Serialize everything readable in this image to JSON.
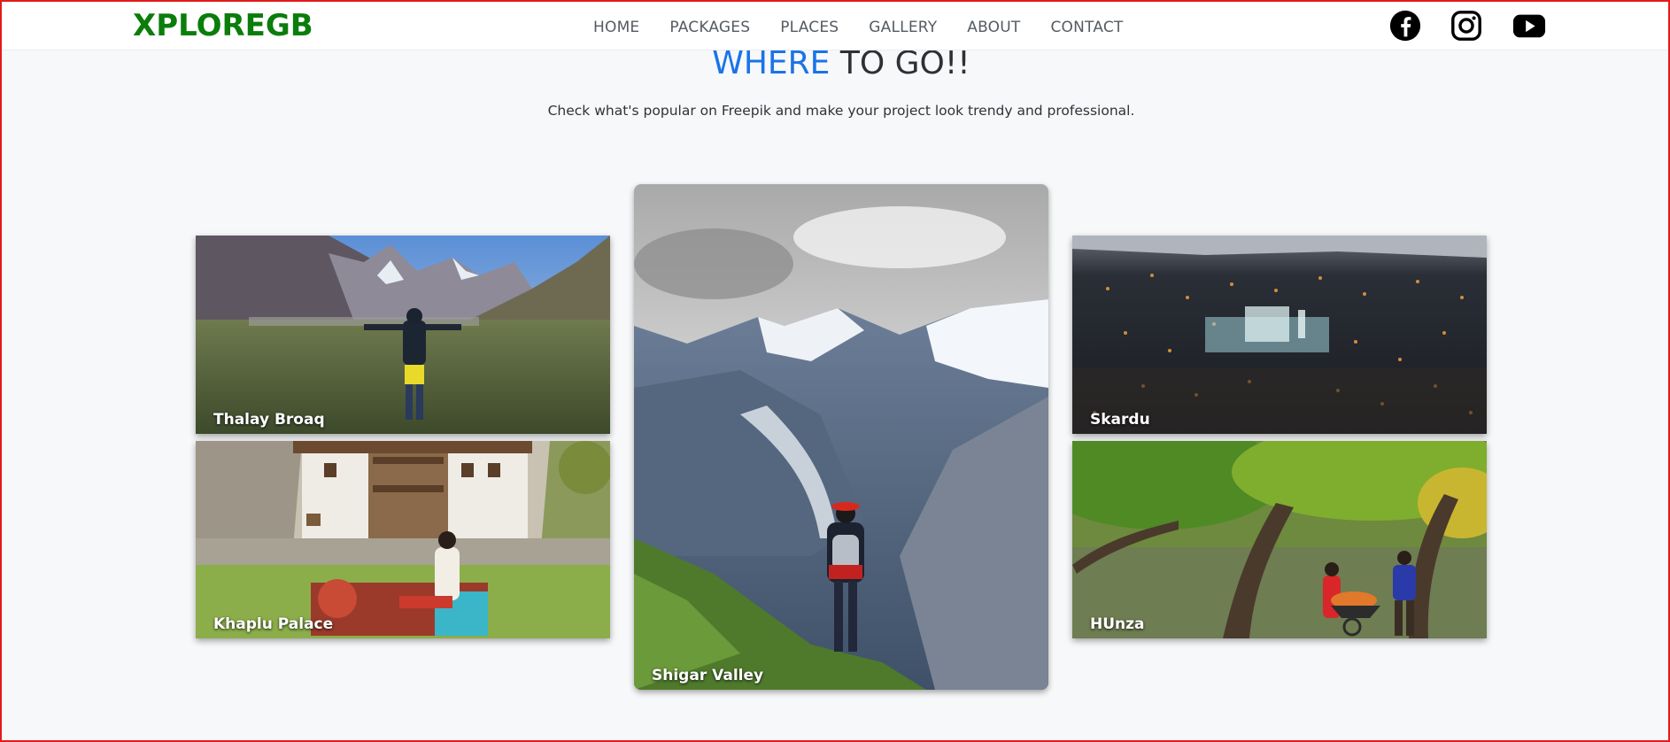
{
  "navbar": {
    "brand": "XPLOREGB",
    "links": [
      "HOME",
      "PACKAGES",
      "PLACES",
      "GALLERY",
      "ABOUT",
      "CONTACT"
    ],
    "socials": [
      "facebook-icon",
      "instagram-icon",
      "youtube-icon"
    ]
  },
  "section": {
    "heading_accent": "WHERE",
    "heading_rest": " TO GO!!",
    "subtitle": "Check what's popular on Freepik and make your project look trendy and professional."
  },
  "destinations": [
    {
      "label": "Thalay Broaq"
    },
    {
      "label": "Khaplu Palace"
    },
    {
      "label": "Shigar Valley"
    },
    {
      "label": "Skardu"
    },
    {
      "label": "HUnza"
    }
  ],
  "colors": {
    "brand": "#0a7d0a",
    "accent": "#1a73e8",
    "background": "#f7f8fa",
    "frame": "#e11b1b"
  }
}
